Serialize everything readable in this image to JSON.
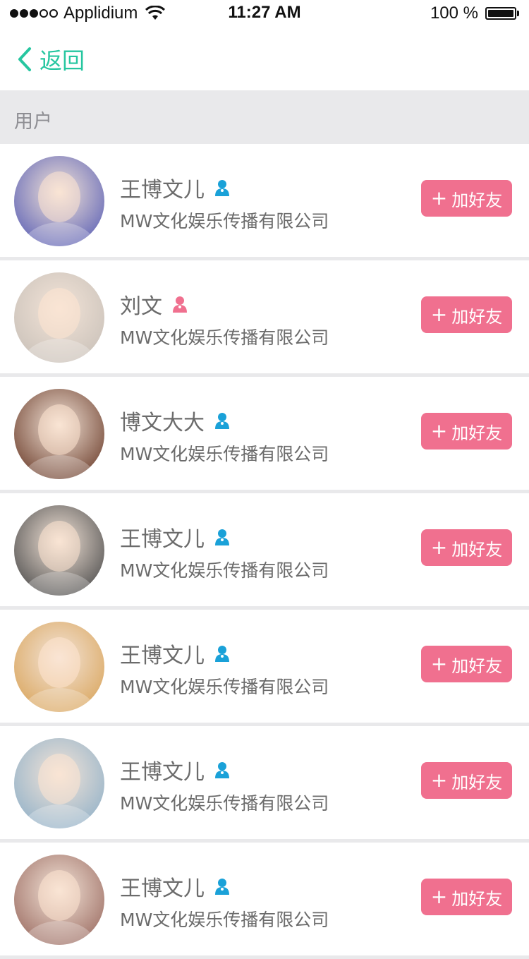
{
  "status_bar": {
    "carrier": "Applidium",
    "time": "11:27 AM",
    "battery": "100 %"
  },
  "nav": {
    "back_label": "返回",
    "back_icon": "chevron-left-icon"
  },
  "section": {
    "title": "用户"
  },
  "colors": {
    "accent_green": "#26c6a0",
    "button_pink": "#f0708f",
    "male_blue": "#1aa1d8",
    "female_pink": "#f0708f"
  },
  "users": [
    {
      "name": "王博文儿",
      "gender": "male",
      "company": "MW文化娱乐传播有限公司",
      "button": "加好友",
      "avatar_color": "#5a5fb5"
    },
    {
      "name": "刘文",
      "gender": "female",
      "company": "MW文化娱乐传播有限公司",
      "button": "加好友",
      "avatar_color": "#c8c0b8"
    },
    {
      "name": "博文大大",
      "gender": "male",
      "company": "MW文化娱乐传播有限公司",
      "button": "加好友",
      "avatar_color": "#6b3c2a"
    },
    {
      "name": "王博文儿",
      "gender": "male",
      "company": "MW文化娱乐传播有限公司",
      "button": "加好友",
      "avatar_color": "#4a4a4a"
    },
    {
      "name": "王博文儿",
      "gender": "male",
      "company": "MW文化娱乐传播有限公司",
      "button": "加好友",
      "avatar_color": "#d9a45a"
    },
    {
      "name": "王博文儿",
      "gender": "male",
      "company": "MW文化娱乐传播有限公司",
      "button": "加好友",
      "avatar_color": "#8fb0c8"
    },
    {
      "name": "王博文儿",
      "gender": "male",
      "company": "MW文化娱乐传播有限公司",
      "button": "加好友",
      "avatar_color": "#9a6a60"
    }
  ]
}
